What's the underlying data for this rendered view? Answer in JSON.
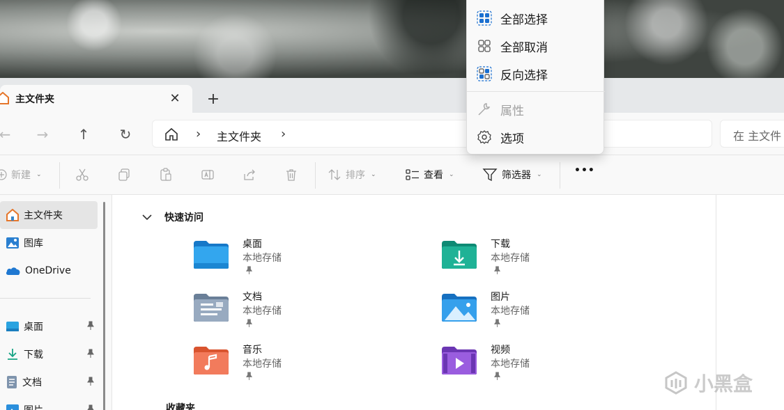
{
  "tab": {
    "title": "主文件夹",
    "close_glyph": "✕",
    "new_tab_glyph": "+"
  },
  "nav": {
    "back_glyph": "←",
    "forward_glyph": "→",
    "up_glyph": "↑",
    "refresh_glyph": "↻",
    "breadcrumb": "主文件夹",
    "separator": "›",
    "search_placeholder": "在 主文件"
  },
  "toolbar": {
    "new_label": "新建",
    "sort_label": "排序",
    "view_label": "查看",
    "filter_label": "筛选器",
    "more_label": "•••"
  },
  "context_menu": {
    "items": [
      {
        "label": "全部选择",
        "icon": "select-all-icon",
        "enabled": true
      },
      {
        "label": "全部取消",
        "icon": "select-none-icon",
        "enabled": true
      },
      {
        "label": "反向选择",
        "icon": "invert-selection-icon",
        "enabled": true
      },
      {
        "label": "属性",
        "icon": "wrench-icon",
        "enabled": false
      },
      {
        "label": "选项",
        "icon": "gear-icon",
        "enabled": true
      }
    ]
  },
  "sidebar": {
    "items": [
      {
        "label": "主文件夹",
        "icon": "home-icon",
        "active": true,
        "pinned": false
      },
      {
        "label": "图库",
        "icon": "gallery-icon",
        "active": false,
        "pinned": false
      },
      {
        "label": "OneDrive",
        "icon": "onedrive-icon",
        "active": false,
        "pinned": false
      },
      {
        "label": "桌面",
        "icon": "desktop-icon",
        "active": false,
        "pinned": true
      },
      {
        "label": "下载",
        "icon": "download-icon",
        "active": false,
        "pinned": true
      },
      {
        "label": "文档",
        "icon": "documents-icon",
        "active": false,
        "pinned": true
      },
      {
        "label": "图片",
        "icon": "pictures-icon",
        "active": false,
        "pinned": true
      }
    ],
    "pin_glyph": "📌"
  },
  "quick_access": {
    "title": "快速访问",
    "tiles": [
      {
        "name": "桌面",
        "location": "本地存储",
        "icon": "desktop-folder-icon",
        "color": "#1e8fd6"
      },
      {
        "name": "下载",
        "location": "本地存储",
        "icon": "downloads-folder-icon",
        "color": "#1aa18a"
      },
      {
        "name": "文档",
        "location": "本地存储",
        "icon": "documents-folder-icon",
        "color": "#7f94ad"
      },
      {
        "name": "图片",
        "location": "本地存储",
        "icon": "pictures-folder-icon",
        "color": "#2a8fdc"
      },
      {
        "name": "音乐",
        "location": "本地存储",
        "icon": "music-folder-icon",
        "color": "#ee6a4e"
      },
      {
        "name": "视频",
        "location": "本地存储",
        "icon": "videos-folder-icon",
        "color": "#8a4fd0"
      }
    ],
    "next_section": "收藏夹"
  },
  "watermark": "小黑盒"
}
